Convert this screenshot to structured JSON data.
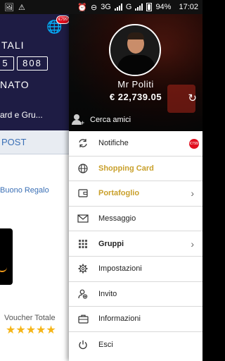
{
  "status_bar": {
    "network": "3G",
    "network2": "G",
    "battery": "94%",
    "time": "17:02"
  },
  "background_app": {
    "cart_badge": "€799",
    "tali_label": "TALI",
    "box_left": "5",
    "box_right": "808",
    "nato_label": "NATO",
    "gruppi_text": "ard e Gru...",
    "post_tab": "POST",
    "buono_regalo": "Buono Regalo",
    "voucher_totale": "Voucher Totale",
    "stars": "★★★★★"
  },
  "drawer": {
    "profile": {
      "name": "Mr Politi",
      "balance": "€ 22,739.05",
      "find_friends": "Cerca amici"
    },
    "menu": [
      {
        "label": "Notifiche",
        "icon": "refresh-arrows-icon",
        "badge": "€799"
      },
      {
        "label": "Shopping Card",
        "icon": "globe-icon"
      },
      {
        "label": "Portafoglio",
        "icon": "wallet-icon"
      },
      {
        "label": "Messaggio",
        "icon": "envelope-icon"
      },
      {
        "label": "Gruppi",
        "icon": "grid-icon"
      },
      {
        "label": "Impostazioni",
        "icon": "gear-icon"
      },
      {
        "label": "Invito",
        "icon": "invite-person-icon"
      },
      {
        "label": "Informazioni",
        "icon": "briefcase-icon"
      },
      {
        "label": "Esci",
        "icon": "power-icon"
      }
    ]
  },
  "colors": {
    "accent_gold": "#c9a02b",
    "badge_red": "#e10f1f",
    "header_navy": "#1e1c44",
    "link_blue": "#3a6fb5"
  }
}
